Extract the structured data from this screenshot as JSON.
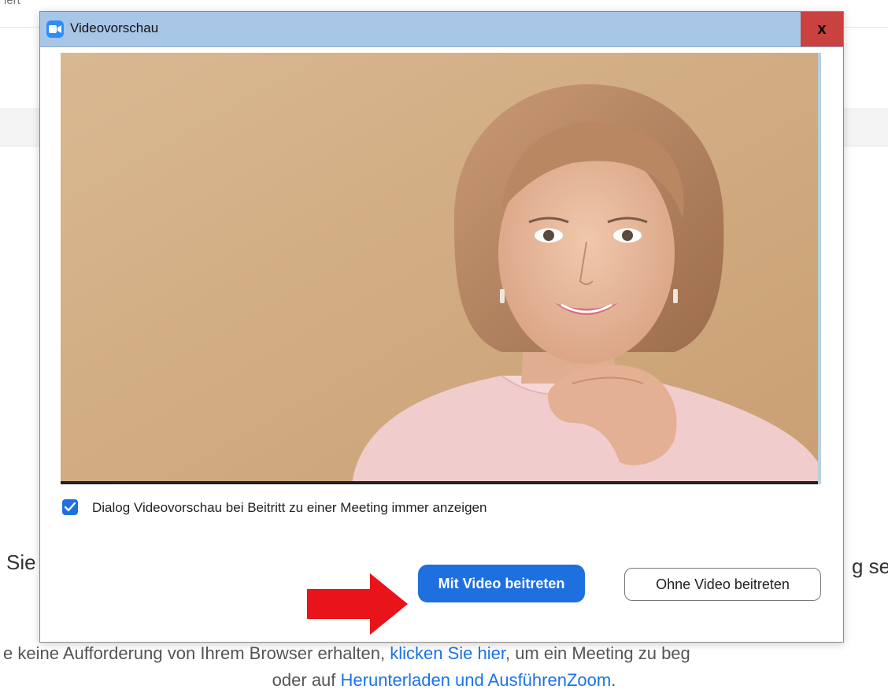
{
  "background": {
    "top_fragment": "iert",
    "left_fragment": "Sie",
    "right_fragment": "g se",
    "line1_pre": "e keine Aufforderung von Ihrem Browser erhalten, ",
    "line1_link": "klicken Sie hier",
    "line1_post": ", um ein Meeting zu beg",
    "line2_pre": "oder auf ",
    "line2_link": "Herunterladen und AusführenZoom",
    "line2_post": "."
  },
  "dialog": {
    "title": "Videovorschau",
    "close_label": "x",
    "checkbox": {
      "label": "Dialog Videovorschau bei Beitritt zu einer Meeting immer anzeigen",
      "checked": true
    },
    "primary_button": "Mit Video beitreten",
    "secondary_button": "Ohne Video beitreten"
  },
  "colors": {
    "accent": "#1e6fe0",
    "titlebar": "#a8c6e6",
    "close": "#c9423f",
    "arrow": "#e8141a"
  }
}
